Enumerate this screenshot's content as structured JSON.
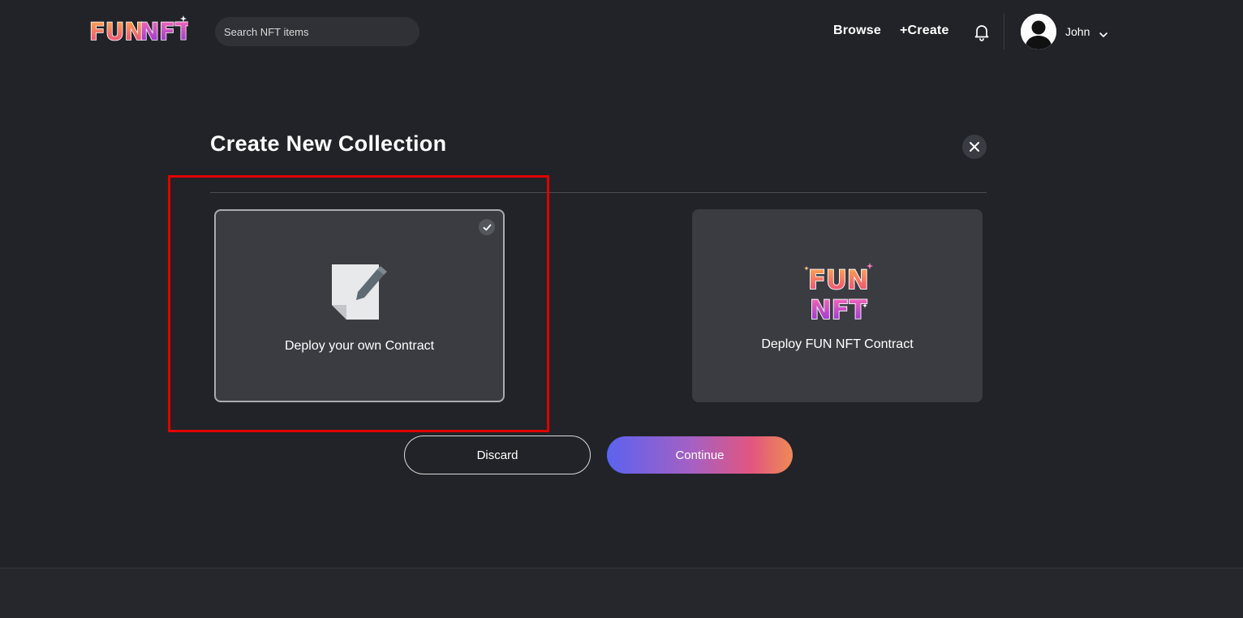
{
  "header": {
    "logo_text": "FUN NFT",
    "search_placeholder": "Search NFT items",
    "nav": {
      "browse": "Browse",
      "create": "+Create"
    },
    "user": {
      "name": "John"
    },
    "icons": {
      "notifications": "bell-icon",
      "account_menu": "chevron-down-icon"
    }
  },
  "modal": {
    "title": "Create New Collection",
    "options": [
      {
        "label": "Deploy your own Contract",
        "icon": "document-pencil-icon",
        "selected": true
      },
      {
        "label": "Deploy FUN NFT Contract",
        "icon": "fun-nft-logo",
        "selected": false
      }
    ],
    "buttons": {
      "discard": "Discard",
      "continue": "Continue"
    }
  },
  "colors": {
    "background": "#212328",
    "card": "#3b3c42",
    "highlight_box": "#e00000",
    "continue_gradient": [
      "#5b63ef",
      "#a460c4",
      "#e2567f",
      "#ef8a55"
    ]
  }
}
